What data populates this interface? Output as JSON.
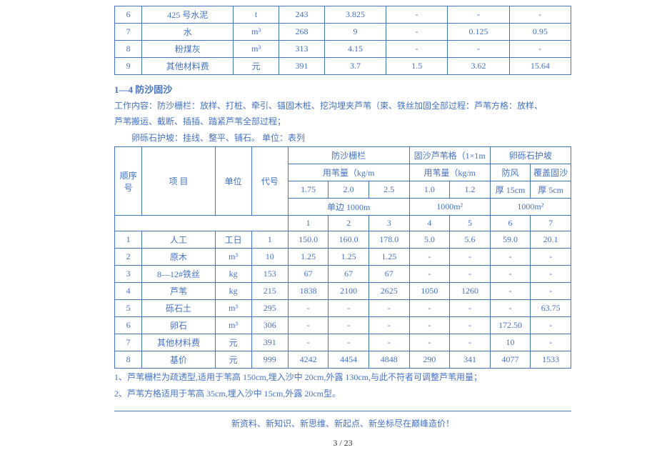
{
  "table1": {
    "rows": [
      {
        "seq": "6",
        "item": "425 号水泥",
        "unit": "t",
        "code": "243",
        "v1": "3.825",
        "v2": "-",
        "v3": "-",
        "v4": "-"
      },
      {
        "seq": "7",
        "item": "水",
        "unit": "m³",
        "code": "268",
        "v1": "9",
        "v2": "-",
        "v3": "0.125",
        "v4": "0.95"
      },
      {
        "seq": "8",
        "item": "粉煤灰",
        "unit": "m³",
        "code": "313",
        "v1": "4.15",
        "v2": "-",
        "v3": "-",
        "v4": "-"
      },
      {
        "seq": "9",
        "item": "其他材料费",
        "unit": "元",
        "code": "391",
        "v1": "3.7",
        "v2": "1.5",
        "v3": "3.62",
        "v4": "15.64"
      }
    ]
  },
  "section": {
    "heading": "1—4 防沙固沙",
    "p1": "工作内容：防沙栅栏：放样、打桩、牵引、锚固木桩、挖沟埋夹芦苇（束、铁丝加固全部过程：芦苇方格：放样、",
    "p2": "芦苇搬运、截断、插插、踏紧芦苇全部过程；",
    "p3": "卵砾石护坡：挂线、整平、铺石。    单位：表列"
  },
  "table2": {
    "header": {
      "seq": "顺序号",
      "item": "项 目",
      "unit": "单位",
      "code": "代号",
      "g1": "防沙栅栏",
      "g2": "固沙芦苇格（1×1m",
      "g3": "卵砾石护坡",
      "sub1": "用苇量（kg/m",
      "sub2": "用苇量（kg/m",
      "sub3a": "防风",
      "sub3b": "覆盖固沙",
      "c1": "1.75",
      "c2": "2.0",
      "c3": "2.5",
      "c4": "1.0",
      "c5": "1.2",
      "c6": "厚 15cm",
      "c7": "厚 5cm",
      "u1": "单边 1000m",
      "u2": "1000m²",
      "u3": "1000m²",
      "n1": "1",
      "n2": "2",
      "n3": "3",
      "n4": "4",
      "n5": "5",
      "n6": "6",
      "n7": "7"
    },
    "rows": [
      {
        "seq": "1",
        "item": "人工",
        "unit": "工日",
        "code": "1",
        "v": [
          "150.0",
          "160.0",
          "178.0",
          "5.0",
          "5.6",
          "59.0",
          "20.1"
        ]
      },
      {
        "seq": "2",
        "item": "原木",
        "unit": "m³",
        "code": "10",
        "v": [
          "1.25",
          "1.25",
          "1.25",
          "-",
          "-",
          "-",
          "-"
        ]
      },
      {
        "seq": "3",
        "item": "8—12#铁丝",
        "unit": "kg",
        "code": "153",
        "v": [
          "67",
          "67",
          "67",
          "-",
          "-",
          "-",
          "-"
        ]
      },
      {
        "seq": "4",
        "item": "芦苇",
        "unit": "kg",
        "code": "215",
        "v": [
          "1838",
          "2100",
          "2625",
          "1050",
          "1260",
          "-",
          "-"
        ]
      },
      {
        "seq": "5",
        "item": "砾石土",
        "unit": "m³",
        "code": "295",
        "v": [
          "-",
          "-",
          "-",
          "-",
          "-",
          "-",
          "63.75"
        ]
      },
      {
        "seq": "6",
        "item": "卵石",
        "unit": "m³",
        "code": "306",
        "v": [
          "-",
          "-",
          "-",
          "-",
          "-",
          "172.50",
          "-"
        ]
      },
      {
        "seq": "7",
        "item": "其他材料费",
        "unit": "元",
        "code": "391",
        "v": [
          "-",
          "-",
          "-",
          "-",
          "-",
          "10",
          "-"
        ]
      },
      {
        "seq": "8",
        "item": "基价",
        "unit": "元",
        "code": "999",
        "v": [
          "4242",
          "4454",
          "4848",
          "290",
          "341",
          "4077",
          "1533"
        ]
      }
    ]
  },
  "notes": {
    "n1": "1、芦苇栅栏为疏透型,适用于苇高 150cm,埋入沙中 20cm,外露 130cm,与此不符者可调整芦苇用量；",
    "n2": "2、芦苇方格适用于苇高 35cm,埋入沙中 15cm,外露 20cm型。"
  },
  "footer": {
    "tagline": "新资料、新知识、新思维、新起点、新坐标尽在巅峰造价！",
    "page": "3  / 23"
  }
}
